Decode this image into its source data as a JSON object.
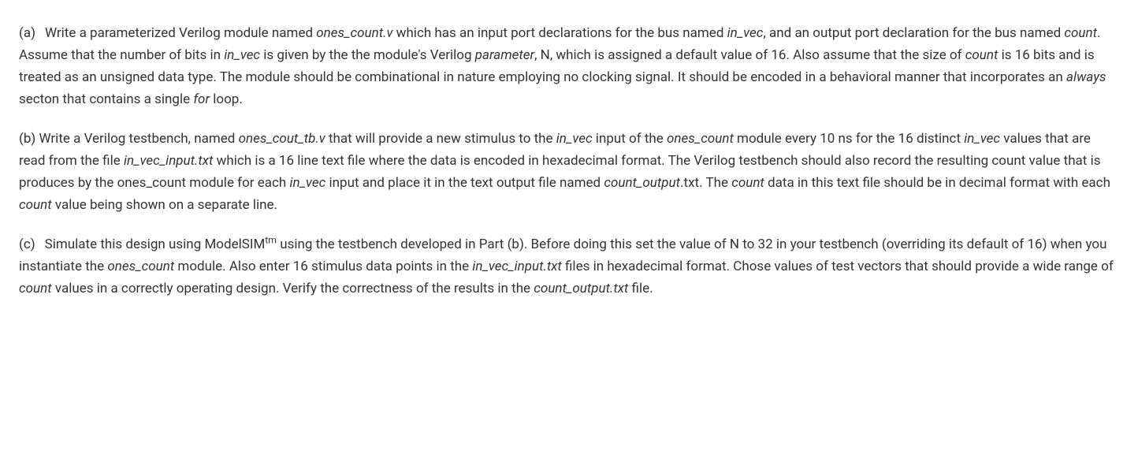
{
  "paragraphs": {
    "a": {
      "label": "(a)",
      "s1_1": "Write a parameterized Verilog module named ",
      "s1_2": "ones_count.v",
      "s1_3": " which has an input port declarations for the bus named ",
      "s1_4": "in_vec",
      "s1_5": ", and an output port declaration for the bus named ",
      "s1_6": "count",
      "s1_7": ". Assume that the number of bits in ",
      "s1_8": "in_vec",
      "s1_9": " is given by the the module's Verilog ",
      "s1_10": "parameter",
      "s1_11": ", N, which is assigned a default value of 16. Also assume that the size of ",
      "s1_12": "count",
      "s1_13": " is 16 bits and is treated as an unsigned data type. The module should be combinational in nature employing no clocking signal. It should be encoded in a behavioral manner that incorporates an ",
      "s1_14": "always",
      "s1_15": " secton that contains a single ",
      "s1_16": "for",
      "s1_17": " loop."
    },
    "b": {
      "label": "(b)",
      "s1_1": "Write a Verilog testbench, named ",
      "s1_2": "ones_cout_tb.v",
      "s1_3": " that will provide a new stimulus to the ",
      "s1_4": "in_vec",
      "s1_5": " input of the ",
      "s1_6": "ones_count",
      "s1_7": " module every 10 ns for the 16 distinct ",
      "s1_8": "in_vec",
      "s1_9": " values that are read from the file ",
      "s1_10": "in_vec_input.txt",
      "s1_11": " which is a 16 line text file where the data is encoded in hexadecimal format. The Verilog testbench should also record the resulting count value that is produces by the ones_count module for each ",
      "s1_12": "in_vec",
      "s1_13": " input and place it in the text output file named ",
      "s1_14": "count_output",
      "s1_15": ".txt. The ",
      "s1_16": "count",
      "s1_17": " data in this text file should be in decimal format with each ",
      "s1_18": "count",
      "s1_19": " value being shown on a separate line."
    },
    "c": {
      "label": "(c)",
      "s1_1": "Simulate this design using ModelSIM",
      "s1_2": "tm",
      "s1_3": " using the testbench developed in Part (b). Before doing this set the value of N to 32 in your testbench (overriding its default of 16) when you instantiate the ",
      "s1_4": "ones_count",
      "s1_5": " module. Also enter 16 stimulus data points in the ",
      "s1_6": "in_vec_input.txt",
      "s1_7": " files in hexadecimal format. Chose values of test vectors that should provide a wide range of ",
      "s1_8": "count",
      "s1_9": " values in a correctly operating design. Verify the correctness of the results in the ",
      "s1_10": "count_output.txt",
      "s1_11": " file."
    }
  }
}
